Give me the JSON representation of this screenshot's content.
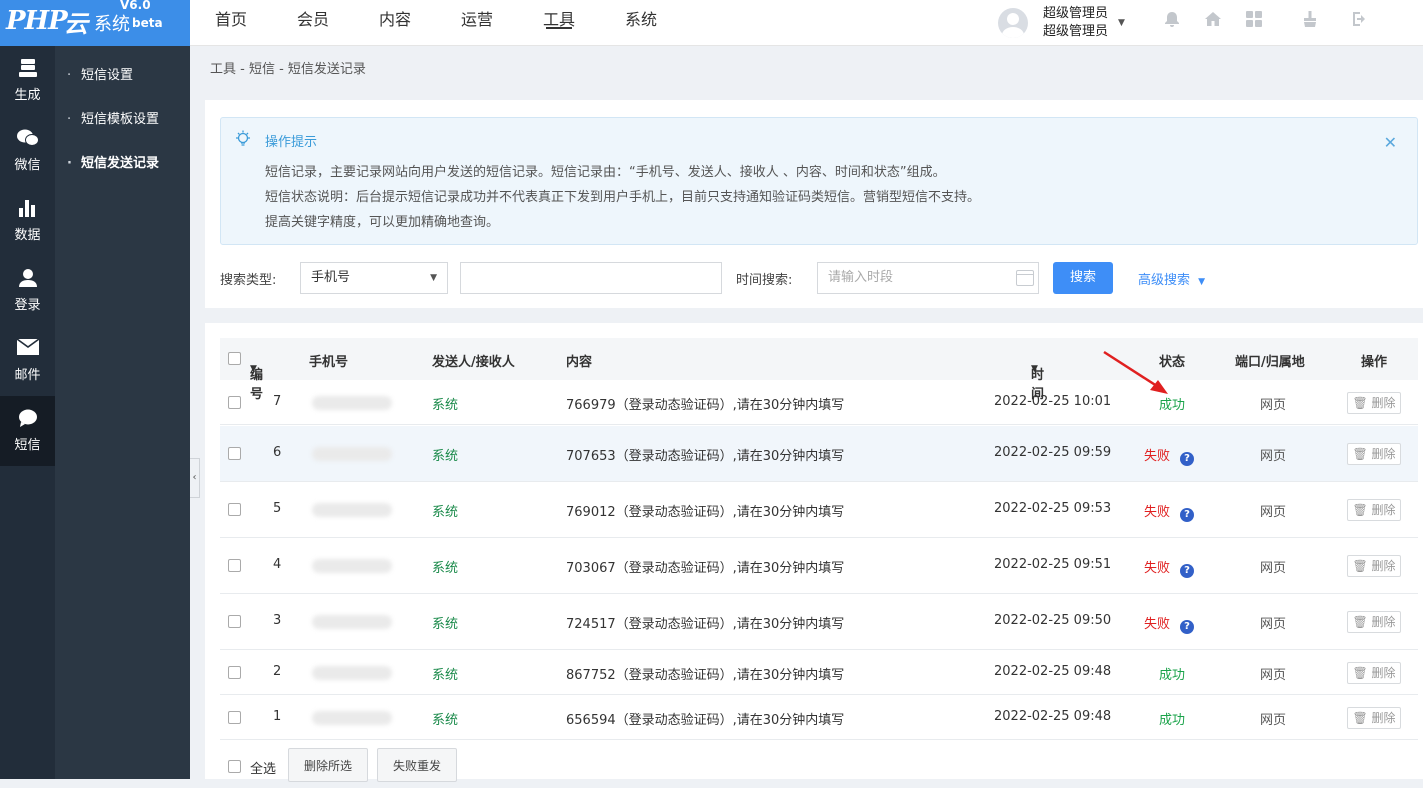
{
  "logo": {
    "php": "PHP",
    "yun": "云",
    "sys": "系统",
    "version": "V6.0",
    "beta": "beta"
  },
  "topnav": [
    {
      "label": "首页"
    },
    {
      "label": "会员"
    },
    {
      "label": "内容"
    },
    {
      "label": "运营"
    },
    {
      "label": "工具"
    },
    {
      "label": "系统"
    }
  ],
  "user": {
    "name_line1": "超级管理员",
    "name_line2": "超级管理员"
  },
  "sidebar": [
    {
      "label": "生成",
      "icon": "database-icon"
    },
    {
      "label": "微信",
      "icon": "wechat-icon"
    },
    {
      "label": "数据",
      "icon": "bar-chart-icon"
    },
    {
      "label": "登录",
      "icon": "user-icon"
    },
    {
      "label": "邮件",
      "icon": "envelope-icon"
    },
    {
      "label": "短信",
      "icon": "chat-bubble-icon"
    }
  ],
  "subnav": [
    {
      "label": "短信设置"
    },
    {
      "label": "短信模板设置"
    },
    {
      "label": "短信发送记录"
    }
  ],
  "breadcrumb": "工具 - 短信 - 短信发送记录",
  "tips": {
    "title": "操作提示",
    "lines": [
      "短信记录，主要记录网站向用户发送的短信记录。短信记录由：“手机号、发送人、接收人 、内容、时间和状态”组成。",
      "短信状态说明：后台提示短信记录成功并不代表真正下发到用户手机上，目前只支持通知验证码类短信。营销型短信不支持。",
      "提高关键字精度，可以更加精确地查询。"
    ]
  },
  "search": {
    "type_label": "搜索类型:",
    "type_value": "手机号",
    "time_label": "时间搜索:",
    "time_placeholder": "请输入时段",
    "search_btn": "搜索",
    "advanced": "高级搜索"
  },
  "table": {
    "headers": {
      "id": "编号",
      "phone": "手机号",
      "sender": "发送人/接收人",
      "content": "内容",
      "time": "时间",
      "status": "状态",
      "port": "端口/归属地",
      "action": "操作"
    },
    "rows": [
      {
        "id": "7",
        "sender": "系统",
        "content": "766979（登录动态验证码）,请在30分钟内填写",
        "time": "2022-02-25 10:01",
        "status": "成功",
        "port": "网页",
        "action": "删除"
      },
      {
        "id": "6",
        "sender": "系统",
        "content": "707653（登录动态验证码）,请在30分钟内填写",
        "time": "2022-02-25 09:59",
        "status": "失败",
        "port": "网页",
        "action": "删除"
      },
      {
        "id": "5",
        "sender": "系统",
        "content": "769012（登录动态验证码）,请在30分钟内填写",
        "time": "2022-02-25 09:53",
        "status": "失败",
        "port": "网页",
        "action": "删除"
      },
      {
        "id": "4",
        "sender": "系统",
        "content": "703067（登录动态验证码）,请在30分钟内填写",
        "time": "2022-02-25 09:51",
        "status": "失败",
        "port": "网页",
        "action": "删除"
      },
      {
        "id": "3",
        "sender": "系统",
        "content": "724517（登录动态验证码）,请在30分钟内填写",
        "time": "2022-02-25 09:50",
        "status": "失败",
        "port": "网页",
        "action": "删除"
      },
      {
        "id": "2",
        "sender": "系统",
        "content": "867752（登录动态验证码）,请在30分钟内填写",
        "time": "2022-02-25 09:48",
        "status": "成功",
        "port": "网页",
        "action": "删除"
      },
      {
        "id": "1",
        "sender": "系统",
        "content": "656594（登录动态验证码）,请在30分钟内填写",
        "time": "2022-02-25 09:48",
        "status": "成功",
        "port": "网页",
        "action": "删除"
      }
    ]
  },
  "footer": {
    "select_all": "全选",
    "delete_selected": "删除所选",
    "resend_failed": "失败重发"
  },
  "colors": {
    "brand": "#3c8ee8",
    "sidebar": "#222d3a",
    "success": "#1aa34a",
    "fail": "#e02020",
    "button": "#3e8ef7"
  }
}
